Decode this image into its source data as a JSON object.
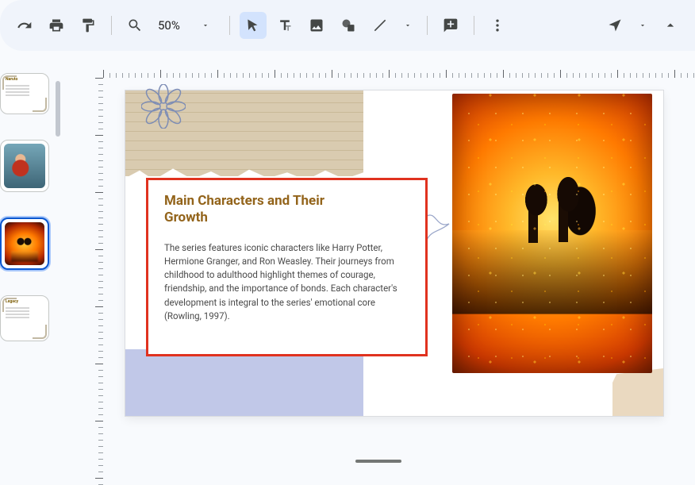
{
  "toolbar": {
    "zoom_value": "50%"
  },
  "thumbnails": [
    {
      "title": "Naruto"
    },
    {
      "title": ""
    },
    {
      "title": ""
    },
    {
      "title": "Legacy"
    }
  ],
  "slide": {
    "title": "Main Characters and Their Growth",
    "body": "The series features iconic characters like Harry Potter, Hermione Granger, and Ron Weasley. Their journeys from childhood to adulthood highlight themes of courage, friendship, and the importance of bonds. Each character's development is integral to the series' emotional core (Rowling, 1997)."
  }
}
